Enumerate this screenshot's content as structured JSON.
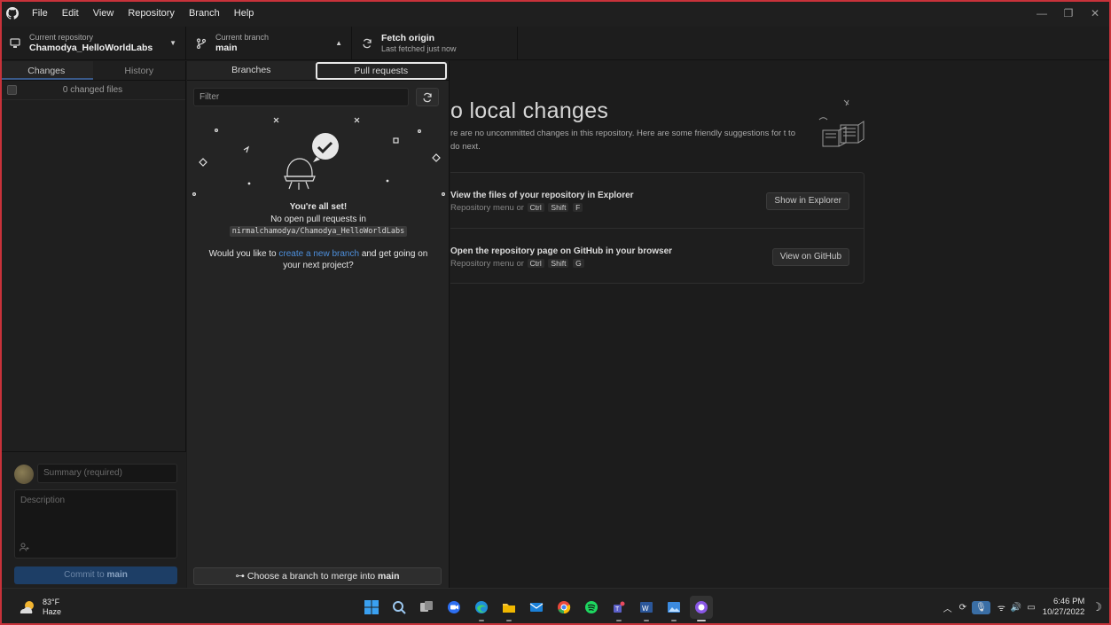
{
  "menu": [
    "File",
    "Edit",
    "View",
    "Repository",
    "Branch",
    "Help"
  ],
  "toolbar": {
    "repo_label": "Current repository",
    "repo_name": "Chamodya_HelloWorldLabs",
    "branch_label": "Current branch",
    "branch_name": "main",
    "fetch_title": "Fetch origin",
    "fetch_sub": "Last fetched just now"
  },
  "sidebar": {
    "tab_changes": "Changes",
    "tab_history": "History",
    "changed_files": "0 changed files",
    "summary_placeholder": "Summary (required)",
    "description_placeholder": "Description",
    "commit_prefix": "Commit to",
    "commit_branch": "main"
  },
  "dropdown": {
    "tab_branches": "Branches",
    "tab_pull_requests": "Pull requests",
    "filter_placeholder": "Filter",
    "all_set": "You're all set!",
    "no_open_prefix": "No open pull requests in",
    "repo_path": "nirmalchamodya/Chamodya_HelloWorldLabs",
    "like_prefix": "Would you like to",
    "like_link": "create a new branch",
    "like_suffix": "and get going on your next project?",
    "merge_prefix": "Choose a branch to merge into",
    "merge_branch": "main"
  },
  "main": {
    "heading": "o local changes",
    "sub": "re are no uncommitted changes in this repository. Here are some friendly suggestions for t to do next.",
    "explorer_title": "View the files of your repository in Explorer",
    "explorer_sub_prefix": "Repository menu or",
    "explorer_keys": [
      "Ctrl",
      "Shift",
      "F"
    ],
    "explorer_button": "Show in Explorer",
    "github_title": "Open the repository page on GitHub in your browser",
    "github_sub_prefix": "Repository menu or",
    "github_keys": [
      "Ctrl",
      "Shift",
      "G"
    ],
    "github_button": "View on GitHub"
  },
  "taskbar": {
    "temp": "83°F",
    "condition": "Haze",
    "time": "6:46 PM",
    "date": "10/27/2022"
  },
  "colors": {
    "accent": "#1d3e66",
    "link": "#4d8fdc",
    "frame": "#c8323a"
  }
}
